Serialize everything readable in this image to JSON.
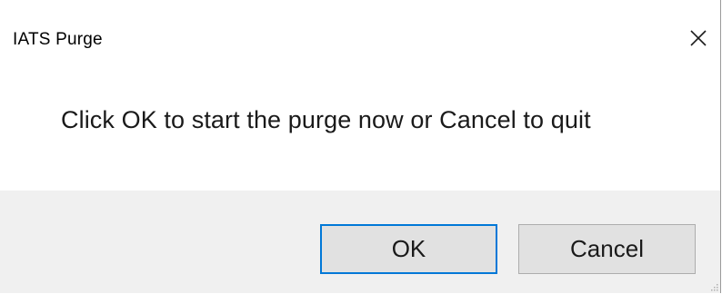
{
  "window": {
    "title": "IATS Purge"
  },
  "dialog": {
    "message": "Click OK to start the purge now or Cancel to quit"
  },
  "buttons": {
    "ok_label": "OK",
    "cancel_label": "Cancel"
  },
  "icons": {
    "close": "close-icon",
    "resize": "resize-grip-icon"
  },
  "colors": {
    "default_button_border": "#0078d7",
    "footer_background": "#f0f0f0",
    "button_background": "#e1e1e1"
  }
}
